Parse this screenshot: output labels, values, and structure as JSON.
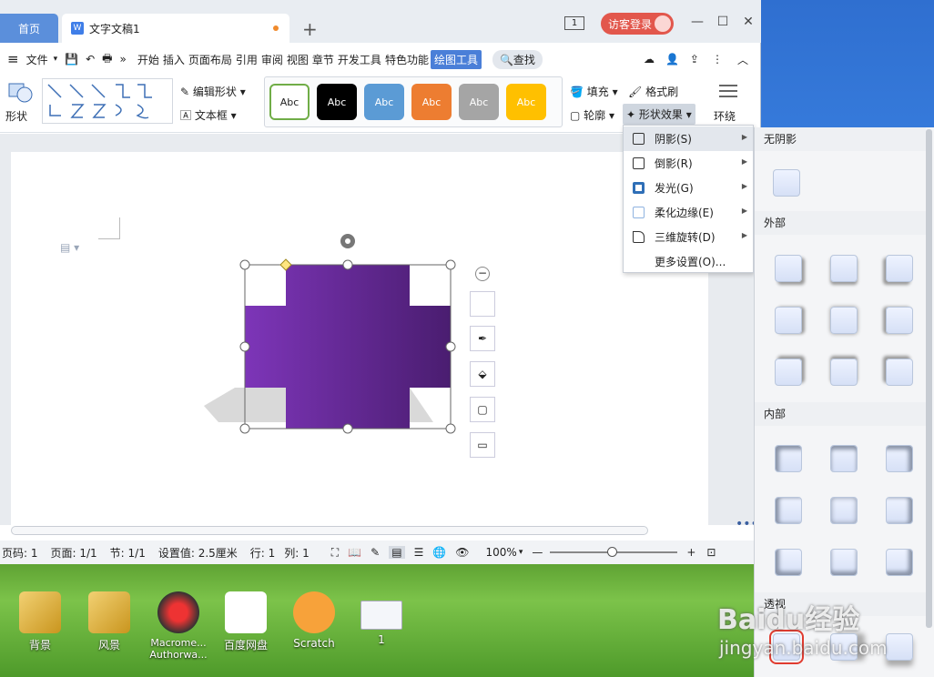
{
  "tabs": {
    "home": "首页",
    "doc": "文字文稿1",
    "plus": "+"
  },
  "titlebar": {
    "page_count": "1",
    "login": "访客登录",
    "minimize": "—",
    "maximize": "☐",
    "close": "✕"
  },
  "menu": {
    "file": "文件",
    "items": [
      "开始",
      "插入",
      "页面布局",
      "引用",
      "审阅",
      "视图",
      "章节",
      "开发工具",
      "特色功能"
    ],
    "active": "绘图工具",
    "search": "查找"
  },
  "ribbon": {
    "shape": "形状",
    "edit_shape": "编辑形状",
    "textbox": "文本框",
    "styles": [
      "Abc",
      "Abc",
      "Abc",
      "Abc",
      "Abc",
      "Abc"
    ],
    "style_colors": [
      "#ffffff",
      "#000000",
      "#5b9bd5",
      "#ed7d31",
      "#a5a5a5",
      "#ffc000"
    ],
    "fill": "填充",
    "format_brush": "格式刷",
    "outline": "轮廓",
    "shape_effect": "形状效果",
    "wrap": "环绕"
  },
  "shape": {
    "color_start": "#7d35b8",
    "color_end": "#4a1d70"
  },
  "dropdown": {
    "items": [
      "阴影(S)",
      "倒影(R)",
      "发光(G)",
      "柔化边缘(E)",
      "三维旋转(D)",
      "更多设置(O)..."
    ]
  },
  "panel": {
    "no_shadow": "无阴影",
    "outer": "外部",
    "inner": "内部",
    "perspective": "透视"
  },
  "status": {
    "page_code": "页码: 1",
    "page": "页面: 1/1",
    "section": "节: 1/1",
    "setting": "设置值: 2.5厘米",
    "row": "行: 1",
    "col": "列: 1",
    "zoom": "100%",
    "zoom_minus": "—",
    "zoom_plus": "+"
  },
  "desktop": {
    "icons": [
      "背景",
      "风景",
      "Macrome... Authorwa...",
      "百度网盘",
      "Scratch",
      "1"
    ]
  },
  "watermark": {
    "text": "Baidu经验",
    "url": "jingyan.baidu.com"
  }
}
